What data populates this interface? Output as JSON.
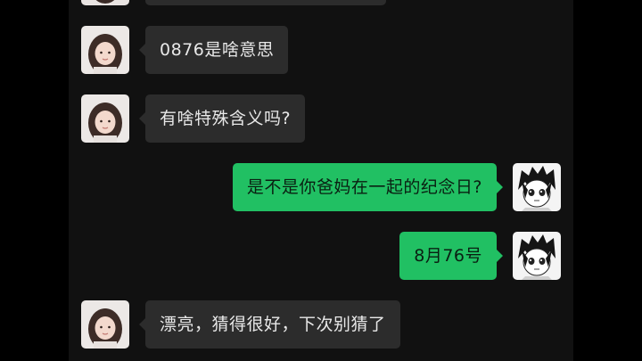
{
  "colors": {
    "background": "#000000",
    "chat_background": "#111111",
    "incoming_bubble": "#2c2c2c",
    "outgoing_bubble": "#21c063"
  },
  "messages": [
    {
      "side": "left",
      "sender_avatar": "girl-photo-avatar-icon",
      "text": ""
    },
    {
      "side": "left",
      "sender_avatar": "girl-photo-avatar-icon",
      "text": "0876是啥意思"
    },
    {
      "side": "left",
      "sender_avatar": "girl-photo-avatar-icon",
      "text": "有啥特殊含义吗?"
    },
    {
      "side": "right",
      "sender_avatar": "anime-boy-avatar-icon",
      "text": "是不是你爸妈在一起的纪念日?"
    },
    {
      "side": "right",
      "sender_avatar": "anime-boy-avatar-icon",
      "text": "8月76号"
    },
    {
      "side": "left",
      "sender_avatar": "girl-photo-avatar-icon",
      "text": "漂亮，猜得很好，下次别猜了"
    }
  ]
}
